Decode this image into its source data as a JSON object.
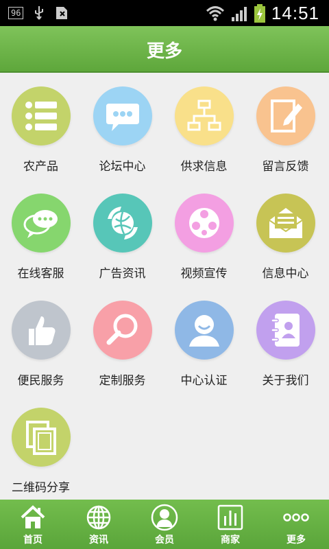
{
  "status_bar": {
    "badge": "96",
    "time": "14:51"
  },
  "header": {
    "title": "更多"
  },
  "items": [
    {
      "label": "农产品",
      "icon": "list-icon",
      "color": "#c3d36a"
    },
    {
      "label": "论坛中心",
      "icon": "chat-bubble-icon",
      "color": "#9cd4f4"
    },
    {
      "label": "供求信息",
      "icon": "org-chart-icon",
      "color": "#f9e08a"
    },
    {
      "label": "留言反馈",
      "icon": "edit-note-icon",
      "color": "#f9c38f"
    },
    {
      "label": "在线客服",
      "icon": "chat-double-icon",
      "color": "#86d66e"
    },
    {
      "label": "广告资讯",
      "icon": "globe-arrows-icon",
      "color": "#57c6b8"
    },
    {
      "label": "视频宣传",
      "icon": "film-reel-icon",
      "color": "#f39fe2"
    },
    {
      "label": "信息中心",
      "icon": "envelope-icon",
      "color": "#c7c455"
    },
    {
      "label": "便民服务",
      "icon": "thumbs-up-icon",
      "color": "#bfc5cd"
    },
    {
      "label": "定制服务",
      "icon": "magnifier-icon",
      "color": "#f8a0a8"
    },
    {
      "label": "中心认证",
      "icon": "user-icon",
      "color": "#8fb8e6"
    },
    {
      "label": "关于我们",
      "icon": "contacts-book-icon",
      "color": "#c1a0ee"
    },
    {
      "label": "二维码分享",
      "icon": "copy-icon",
      "color": "#c3d36a"
    }
  ],
  "tabs": [
    {
      "label": "首页",
      "icon": "home-icon"
    },
    {
      "label": "资讯",
      "icon": "globe-icon"
    },
    {
      "label": "会员",
      "icon": "member-icon"
    },
    {
      "label": "商家",
      "icon": "bar-chart-icon"
    },
    {
      "label": "更多",
      "icon": "more-dots-icon"
    }
  ]
}
